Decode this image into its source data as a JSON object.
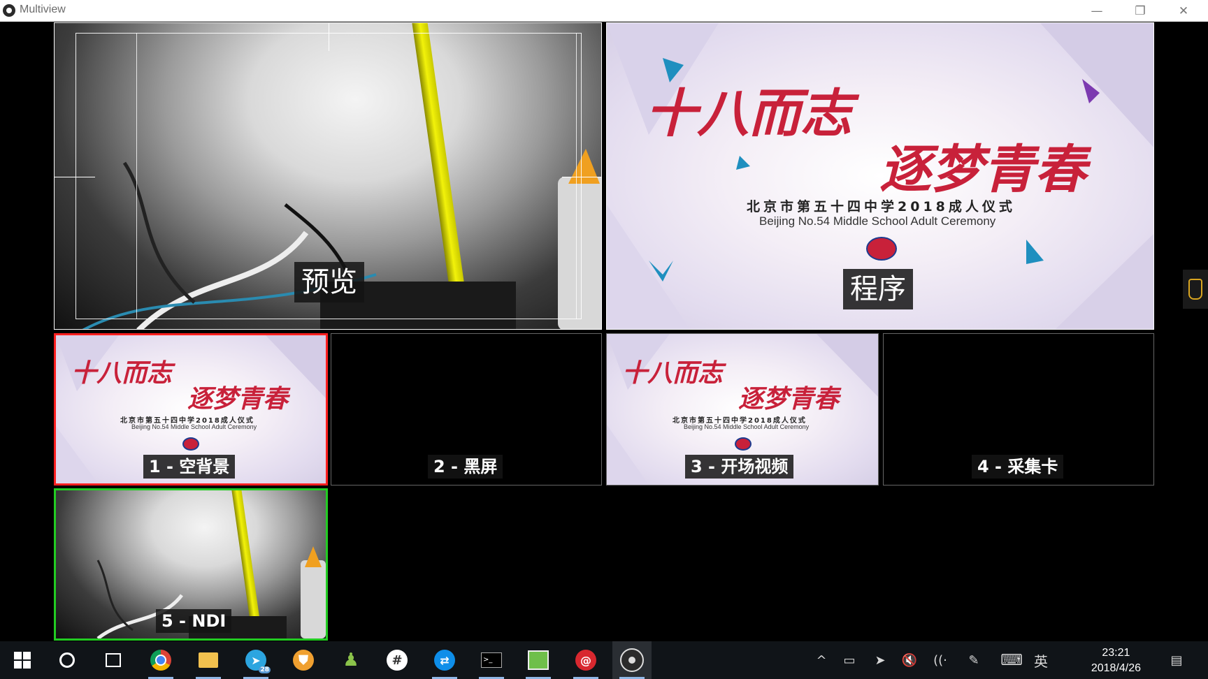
{
  "window": {
    "title": "Multiview",
    "minimize_glyph": "—",
    "restore_glyph": "❐",
    "close_glyph": "✕"
  },
  "multiview": {
    "preview_label": "预览",
    "program_label": "程序",
    "scenes": [
      {
        "label": "1 - 空背景",
        "content": "ceremony",
        "border": "#ff2020"
      },
      {
        "label": "2 - 黑屏",
        "content": "black",
        "border": "#555555"
      },
      {
        "label": "3 - 开场视频",
        "content": "ceremony",
        "border": "#555555"
      },
      {
        "label": "4 - 采集卡",
        "content": "black",
        "border": "#555555"
      },
      {
        "label": "5 - NDI",
        "content": "camera",
        "border": "#22cc22"
      }
    ]
  },
  "ceremony": {
    "title_line1": "十八而志",
    "title_line2": "逐梦青春",
    "subtitle_cn": "北京市第五十四中学2018成人仪式",
    "subtitle_en": "Beijing No.54 Middle School Adult Ceremony"
  },
  "colors": {
    "preview_border": "#ffffff",
    "program_border": "#ffffff",
    "selected_scene": "#ff2020",
    "live_scene": "#22cc22",
    "accent_red": "#c8213a"
  },
  "taskbar": {
    "apps": [
      {
        "name": "start-icon",
        "glyph": "⊞"
      },
      {
        "name": "cortana-icon",
        "glyph": "○"
      },
      {
        "name": "task-view-icon",
        "glyph": "⧉"
      },
      {
        "name": "chrome-icon",
        "glyph": "◉"
      },
      {
        "name": "file-explorer-icon",
        "glyph": "▬"
      },
      {
        "name": "telegram-icon",
        "glyph": "➤",
        "badge": "28"
      },
      {
        "name": "vpn-shield-icon",
        "glyph": "⛊"
      },
      {
        "name": "contacts-icon",
        "glyph": "♟"
      },
      {
        "name": "hash-icon",
        "glyph": "#"
      },
      {
        "name": "teamviewer-icon",
        "glyph": "⇄"
      },
      {
        "name": "terminal-icon",
        "glyph": ">_"
      },
      {
        "name": "image-editor-icon",
        "glyph": "▦"
      },
      {
        "name": "snail-app-icon",
        "glyph": "@"
      },
      {
        "name": "obs-icon",
        "glyph": "◎"
      }
    ],
    "tray": {
      "chevron": "^",
      "battery": "▭",
      "send": "➤",
      "volume_muted": "🔇",
      "wifi": "((·",
      "pen": "✎",
      "keyboard": "⌨",
      "ime": "英",
      "notification": "▤"
    },
    "time": "23:21",
    "date": "2018/4/26"
  }
}
